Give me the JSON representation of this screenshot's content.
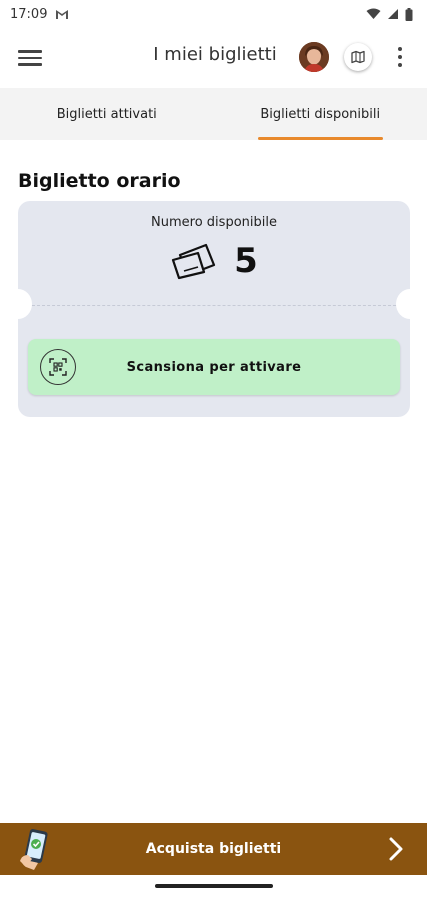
{
  "status_bar": {
    "time": "17:09"
  },
  "header": {
    "title": "I miei biglietti"
  },
  "tabs": [
    {
      "label": "Biglietti attivati",
      "active": false
    },
    {
      "label": "Biglietti disponibili",
      "active": true
    }
  ],
  "section": {
    "title": "Biglietto orario"
  },
  "ticket": {
    "count_label": "Numero disponibile",
    "count": "5",
    "scan_label": "Scansiona per attivare"
  },
  "footer": {
    "buy_label": "Acquista biglietti"
  },
  "colors": {
    "accent": "#e8892c",
    "footer_bg": "#8a5410",
    "scan_bg": "#c0f0c8",
    "card_bg": "#e4e7ef"
  },
  "icons": [
    "menu-icon",
    "avatar",
    "map-icon",
    "more-vert-icon",
    "tickets-icon",
    "qr-scan-icon",
    "phone-ticket-icon",
    "chevron-right-icon"
  ]
}
